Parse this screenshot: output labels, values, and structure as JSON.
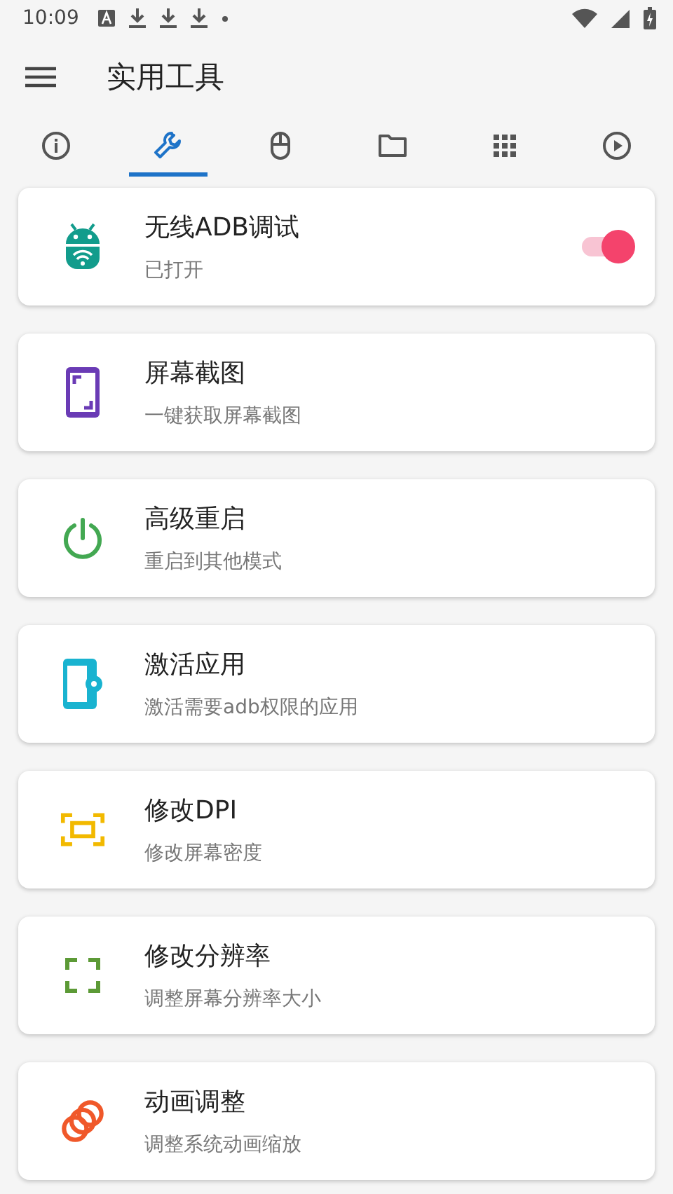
{
  "status_bar": {
    "time": "10:09"
  },
  "toolbar": {
    "title": "实用工具"
  },
  "tabs": [
    {
      "selected": false
    },
    {
      "selected": true
    },
    {
      "selected": false
    },
    {
      "selected": false
    },
    {
      "selected": false
    },
    {
      "selected": false
    }
  ],
  "tools": [
    {
      "kind": "switch",
      "title": "无线ADB调试",
      "subtitle": "已打开",
      "on": true
    },
    {
      "kind": "plain",
      "title": "屏幕截图",
      "subtitle": "一键获取屏幕截图"
    },
    {
      "kind": "plain",
      "title": "高级重启",
      "subtitle": "重启到其他模式"
    },
    {
      "kind": "plain",
      "title": "激活应用",
      "subtitle": "激活需要adb权限的应用"
    },
    {
      "kind": "plain",
      "title": "修改DPI",
      "subtitle": "修改屏幕密度"
    },
    {
      "kind": "plain",
      "title": "修改分辨率",
      "subtitle": "调整屏幕分辨率大小"
    },
    {
      "kind": "plain",
      "title": "动画调整",
      "subtitle": "调整系统动画缩放"
    }
  ]
}
